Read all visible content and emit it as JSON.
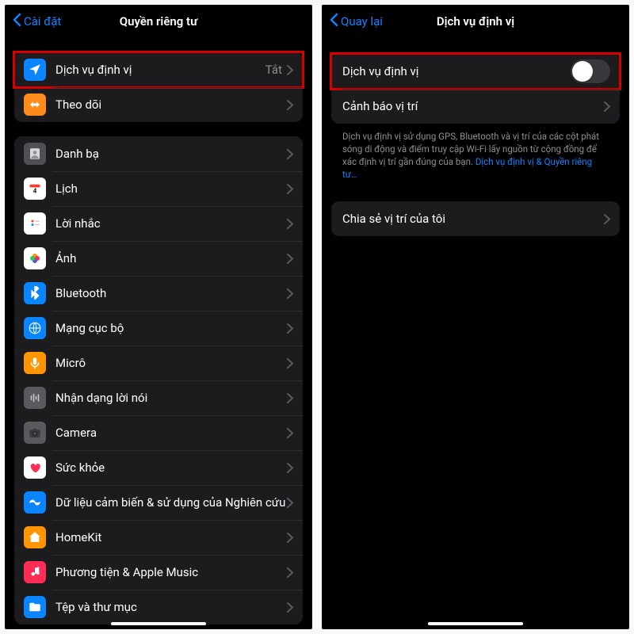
{
  "left": {
    "back_label": "Cài đặt",
    "title": "Quyền riêng tư",
    "group1": {
      "location": {
        "label": "Dịch vụ định vị",
        "value": "Tắt"
      },
      "tracking": {
        "label": "Theo dõi"
      }
    },
    "group2": [
      {
        "key": "contacts",
        "label": "Danh bạ"
      },
      {
        "key": "calendar",
        "label": "Lịch"
      },
      {
        "key": "reminders",
        "label": "Lời nhắc"
      },
      {
        "key": "photos",
        "label": "Ảnh"
      },
      {
        "key": "bluetooth",
        "label": "Bluetooth"
      },
      {
        "key": "localnet",
        "label": "Mạng cục bộ"
      },
      {
        "key": "mic",
        "label": "Micrô"
      },
      {
        "key": "speech",
        "label": "Nhận dạng lời nói"
      },
      {
        "key": "camera",
        "label": "Camera"
      },
      {
        "key": "health",
        "label": "Sức khỏe"
      },
      {
        "key": "research",
        "label": "Dữ liệu cảm biến & sử dụng của Nghiên cứu"
      },
      {
        "key": "homekit",
        "label": "HomeKit"
      },
      {
        "key": "media",
        "label": "Phương tiện & Apple Music"
      },
      {
        "key": "files",
        "label": "Tệp và thư mục"
      }
    ]
  },
  "right": {
    "back_label": "Quay lại",
    "title": "Dịch vụ định vị",
    "row1_label": "Dịch vụ định vị",
    "row2_label": "Cảnh báo vị trí",
    "footer_text": "Dịch vụ định vị sử dụng GPS, Bluetooth và vị trí của các cột phát sóng di động và điểm truy cập Wi-Fi lấy nguồn từ cộng đồng để xác định vị trí gần đúng của bạn. ",
    "footer_link": "Dịch vụ định vị & Quyền riêng tư…",
    "row3_label": "Chia sẻ vị trí của tôi"
  }
}
